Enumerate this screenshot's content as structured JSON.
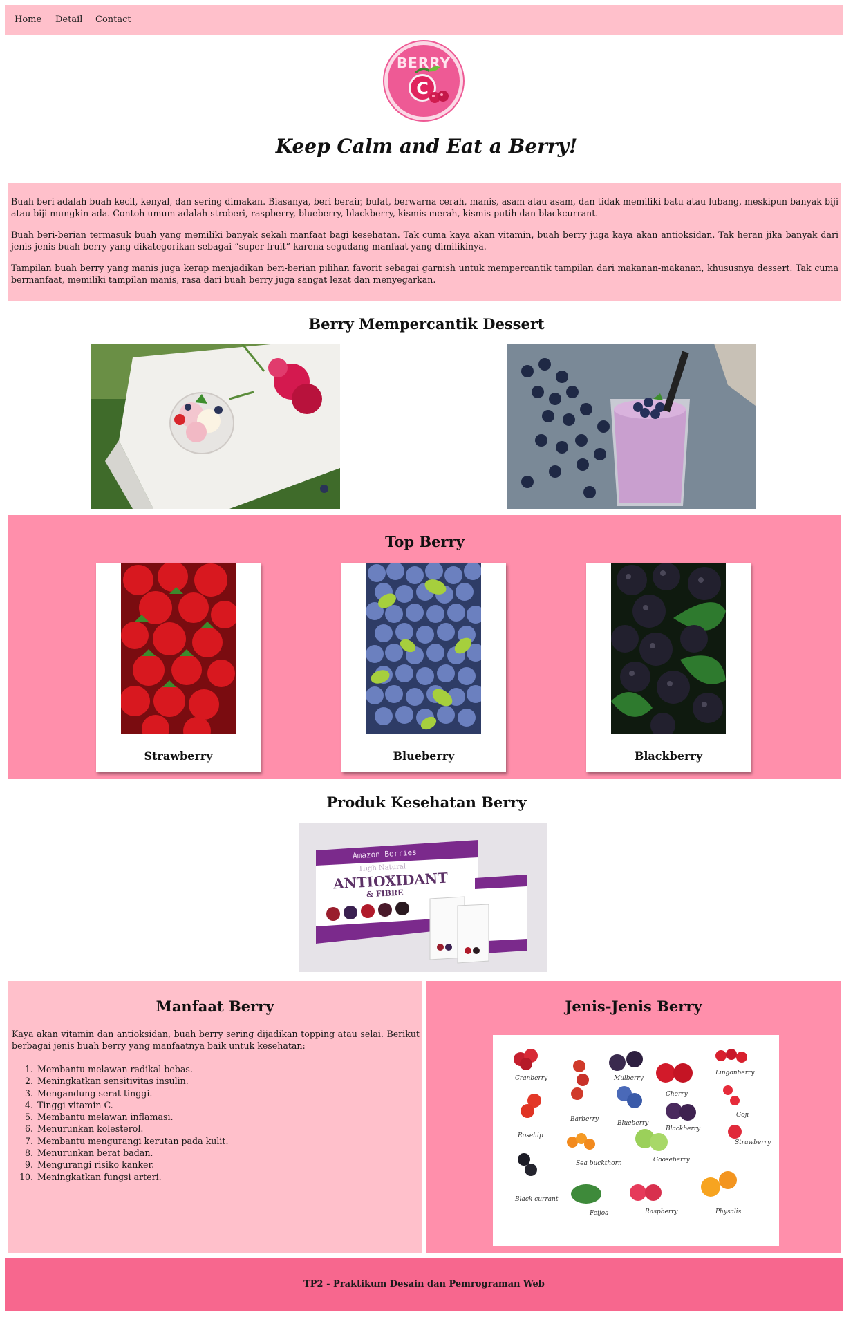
{
  "nav": {
    "items": [
      "Home",
      "Detail",
      "Contact"
    ]
  },
  "logo": {
    "word": "BERRY",
    "letter": "C"
  },
  "tagline": "Keep Calm and Eat a Berry!",
  "intro": {
    "paragraphs": [
      "Buah beri adalah buah kecil, kenyal, dan sering dimakan. Biasanya, beri berair, bulat, berwarna cerah, manis, asam atau asam, dan tidak memiliki batu atau lubang, meskipun banyak biji atau biji mungkin ada. Contoh umum adalah stroberi, raspberry, blueberry, blackberry, kismis merah, kismis putih dan blackcurrant.",
      "Buah beri-berian termasuk buah yang memiliki banyak sekali manfaat bagi kesehatan. Tak cuma kaya akan vitamin, buah berry juga kaya akan antioksidan. Tak heran jika banyak dari jenis-jenis buah berry yang dikategorikan sebagai “super fruit” karena segudang manfaat yang dimilikinya.",
      "Tampilan buah berry yang manis juga kerap menjadikan beri-berian pilihan favorit sebagai garnish untuk mempercantik tampilan dari makanan-makanan, khususnya dessert. Tak cuma bermanfaat, memiliki tampilan manis, rasa dari buah berry juga sangat lezat dan menyegarkan."
    ]
  },
  "dessert": {
    "title": "Berry Mempercantik Dessert"
  },
  "top_berry": {
    "title": "Top Berry",
    "cards": [
      {
        "label": "Strawberry",
        "color": "#c8161e"
      },
      {
        "label": "Blueberry",
        "color": "#5f76b8"
      },
      {
        "label": "Blackberry",
        "color": "#1c1a24"
      }
    ]
  },
  "product": {
    "title": "Produk Kesehatan Berry",
    "brand": "Amazon Berries",
    "subtitle": "High Natural",
    "headline": "ANTIOXIDANT",
    "subheadline": "& FIBRE"
  },
  "manfaat": {
    "title": "Manfaat Berry",
    "intro": "Kaya akan vitamin dan antioksidan, buah berry sering dijadikan topping atau selai. Berikut berbagai jenis buah berry yang manfaatnya baik untuk kesehatan:",
    "items": [
      "Membantu melawan radikal bebas.",
      "Meningkatkan sensitivitas insulin.",
      "Mengandung serat tinggi.",
      "Tinggi vitamin C.",
      "Membantu melawan inflamasi.",
      "Menurunkan kolesterol.",
      "Membantu mengurangi kerutan pada kulit.",
      "Menurunkan berat badan.",
      "Mengurangi risiko kanker.",
      "Meningkatkan fungsi arteri."
    ]
  },
  "jenis": {
    "title": "Jenis-Jenis Berry",
    "labels": [
      "Cranberry",
      "Mulberry",
      "Lingonberry",
      "Cherry",
      "Goji",
      "Barberry",
      "Blueberry",
      "Blackberry",
      "Rosehip",
      "Strawberry",
      "Sea buckthorn",
      "Gooseberry",
      "Black currant",
      "Feijoa",
      "Raspberry",
      "Physalis"
    ]
  },
  "footer": {
    "text": "TP2 - Praktikum Desain dan Pemrograman Web"
  },
  "colors": {
    "light_pink": "#ffc0cb",
    "pink": "#ff8fab",
    "footer_pink": "#f7678e",
    "logo_pink": "#ee5a95"
  }
}
